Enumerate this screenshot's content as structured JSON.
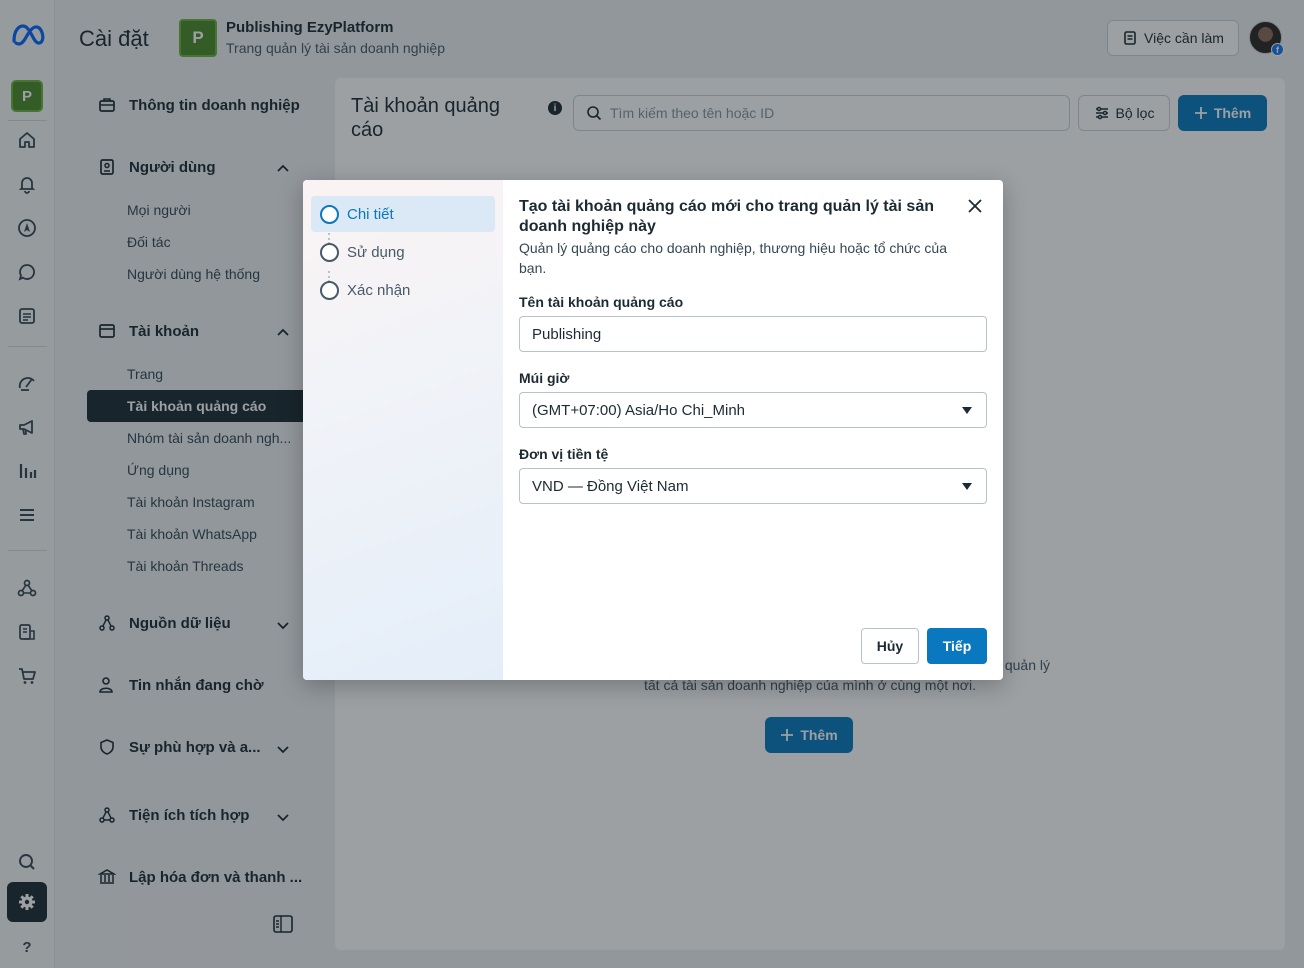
{
  "header": {
    "title": "Cài đặt",
    "business_initial": "P",
    "business_name": "Publishing EzyPlatform",
    "business_subtitle": "Trang quản lý tài sản doanh nghiệp",
    "todo_label": "Việc cần làm"
  },
  "rail": {
    "business_initial": "P",
    "icons": [
      "home-icon",
      "bell-icon",
      "compass-icon",
      "chat-icon",
      "pages-icon",
      "speedometer-icon",
      "megaphone-icon",
      "bar-chart-icon",
      "menu-icon",
      "nodes-icon",
      "coins-icon",
      "cart-icon",
      "search-icon",
      "gear-icon",
      "help-icon"
    ],
    "help_label": "?"
  },
  "nav": {
    "business_info": "Thông tin doanh nghiệp",
    "users": {
      "label": "Người dùng",
      "items": [
        "Mọi người",
        "Đối tác",
        "Người dùng hệ thống"
      ]
    },
    "accounts": {
      "label": "Tài khoản",
      "items": [
        "Trang",
        "Tài khoản quảng cáo",
        "Nhóm tài sản doanh ngh...",
        "Ứng dụng",
        "Tài khoản Instagram",
        "Tài khoản WhatsApp",
        "Tài khoản Threads"
      ]
    },
    "data_sources": "Nguồn dữ liệu",
    "pending_messages": "Tin nhắn đang chờ",
    "compliance": "Sự phù hợp và a...",
    "integrations": "Tiện ích tích hợp",
    "billing": "Lập hóa đơn và thanh ..."
  },
  "main": {
    "title": "Tài khoản quảng cáo",
    "search_placeholder": "Tìm kiếm theo tên hoặc ID",
    "filter_label": "Bộ lọc",
    "add_label": "Thêm",
    "empty_line1": "quản lý",
    "empty_line2": "tất cả tài sản doanh nghiệp của mình ở cùng một nơi.",
    "empty_add_label": "Thêm"
  },
  "modal": {
    "steps": [
      "Chi tiết",
      "Sử dụng",
      "Xác nhận"
    ],
    "title": "Tạo tài khoản quảng cáo mới cho trang quản lý tài sản doanh nghiệp này",
    "description": "Quản lý quảng cáo cho doanh nghiệp, thương hiệu hoặc tổ chức của bạn.",
    "account_name_label": "Tên tài khoản quảng cáo",
    "account_name_value": "Publishing",
    "timezone_label": "Múi giờ",
    "timezone_value": "(GMT+07:00) Asia/Ho Chi_Minh",
    "currency_label": "Đơn vị tiền tệ",
    "currency_value": "VND — Đồng Việt Nam",
    "cancel_label": "Hủy",
    "next_label": "Tiếp"
  },
  "colors": {
    "primary": "#0a78be",
    "dark": "#1c2b33",
    "business_green": "#4a8a2a"
  }
}
